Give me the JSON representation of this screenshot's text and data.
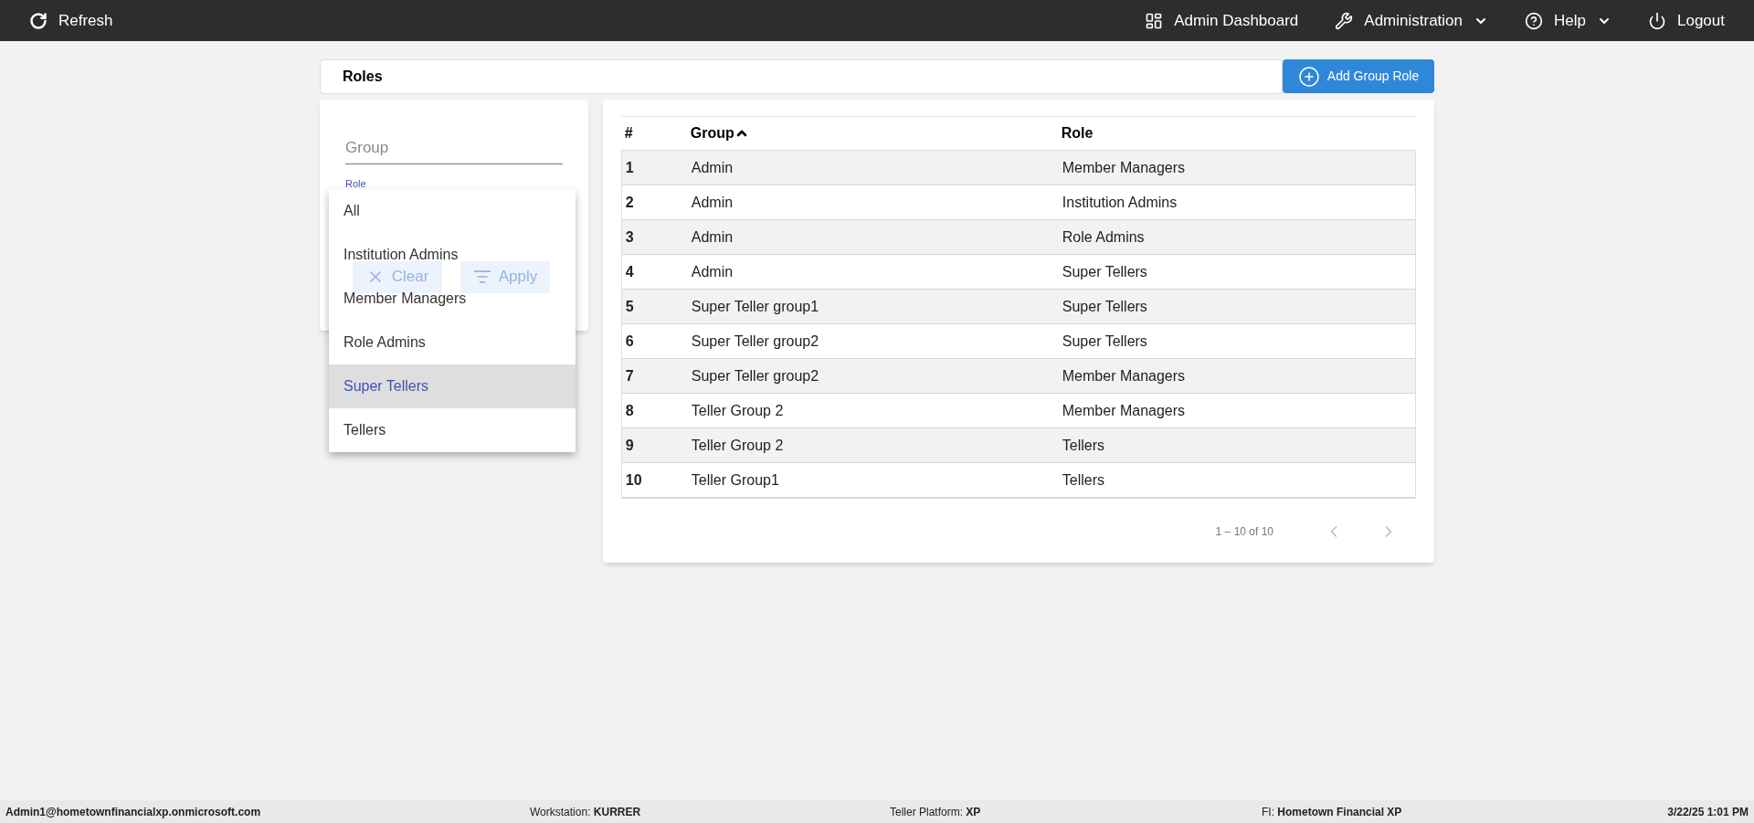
{
  "top_bar": {
    "refresh": "Refresh",
    "nav": [
      {
        "kind": "dashboard",
        "label": "Admin Dashboard",
        "caret": false
      },
      {
        "kind": "wrench",
        "label": "Administration",
        "caret": true
      },
      {
        "kind": "help",
        "label": "Help",
        "caret": true
      },
      {
        "kind": "power",
        "label": "Logout",
        "caret": false
      }
    ]
  },
  "page_title": "Roles",
  "add_button": "Add Group Role",
  "filters": {
    "group_placeholder": "Group",
    "role_label": "Role",
    "clear": "Clear",
    "apply": "Apply"
  },
  "role_menu": [
    {
      "label": "All",
      "selected": false
    },
    {
      "label": "Institution Admins",
      "selected": false
    },
    {
      "label": "Member Managers",
      "selected": false
    },
    {
      "label": "Role Admins",
      "selected": false
    },
    {
      "label": "Super Tellers",
      "selected": true
    },
    {
      "label": "Tellers",
      "selected": false
    }
  ],
  "table": {
    "columns": [
      {
        "label": "#",
        "sorted": false
      },
      {
        "label": "Group",
        "sorted": true
      },
      {
        "label": "Role",
        "sorted": false
      }
    ],
    "rows": [
      [
        "1",
        "Admin",
        "Member Managers"
      ],
      [
        "2",
        "Admin",
        "Institution Admins"
      ],
      [
        "3",
        "Admin",
        "Role Admins"
      ],
      [
        "4",
        "Admin",
        "Super Tellers"
      ],
      [
        "5",
        "Super Teller group1",
        "Super Tellers"
      ],
      [
        "6",
        "Super Teller group2",
        "Super Tellers"
      ],
      [
        "7",
        "Super Teller group2",
        "Member Managers"
      ],
      [
        "8",
        "Teller Group 2",
        "Member Managers"
      ],
      [
        "9",
        "Teller Group 2",
        "Tellers"
      ],
      [
        "10",
        "Teller Group1",
        "Tellers"
      ]
    ]
  },
  "pagination": "1 – 10 of 10",
  "status_bar": {
    "user": "Admin1@hometownfinancialxp.onmicrosoft.com",
    "fields": [
      {
        "label": "Workstation: ",
        "value": "KURRER"
      },
      {
        "label": "Teller Platform: ",
        "value": "XP"
      },
      {
        "label": "FI: ",
        "value": "Hometown Financial XP"
      }
    ],
    "time": "3/22/25 1:01 PM"
  }
}
